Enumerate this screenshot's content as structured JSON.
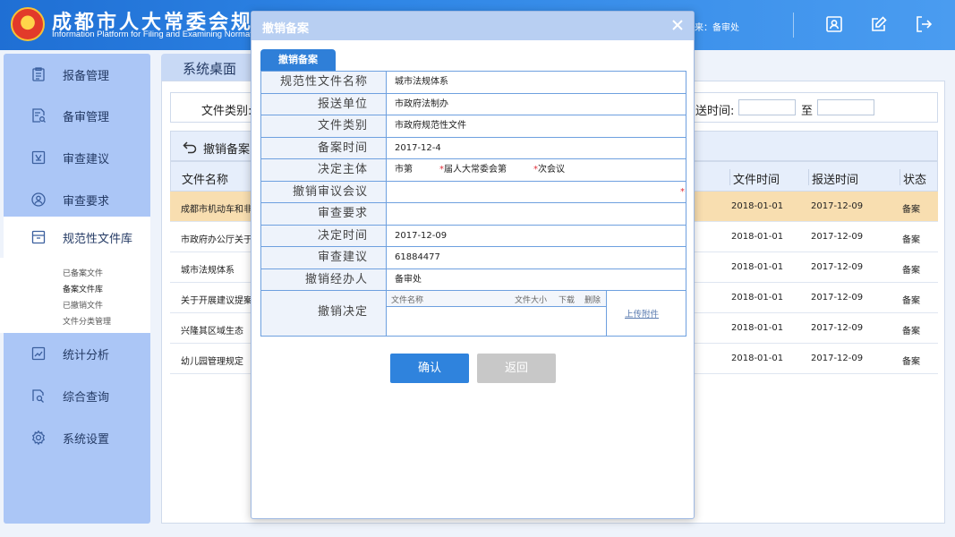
{
  "header": {
    "title_cn": "成都市人大常委会规范",
    "title_en": "Information Platform for Filing and Examining Normative D",
    "source": "来：备审处",
    "icons": [
      "contact-card-icon",
      "edit-icon",
      "logout-icon"
    ]
  },
  "sidebar": {
    "items": [
      {
        "label": "报备管理",
        "icon": "clipboard-icon"
      },
      {
        "label": "备审管理",
        "icon": "document-search-icon"
      },
      {
        "label": "审查建议",
        "icon": "suggestion-icon"
      },
      {
        "label": "审查要求",
        "icon": "user-circle-icon"
      },
      {
        "label": "规范性文件库",
        "icon": "archive-icon"
      },
      {
        "label": "统计分析",
        "icon": "chart-icon"
      },
      {
        "label": "综合查询",
        "icon": "search-doc-icon"
      },
      {
        "label": "系统设置",
        "icon": "gear-icon"
      }
    ],
    "sub_items": [
      {
        "label": "已备案文件"
      },
      {
        "label": "备案文件库"
      },
      {
        "label": "已撤销文件"
      },
      {
        "label": "文件分类管理"
      }
    ]
  },
  "main": {
    "tab_title": "系统桌面",
    "filter": {
      "category_label": "文件类别:",
      "date_label": "送时间:",
      "to_label": "至"
    },
    "action": {
      "label": "撤销备案"
    },
    "table": {
      "headers": {
        "name": "文件名称",
        "file_time": "文件时间",
        "send_time": "报送时间",
        "status": "状态"
      },
      "rows": [
        {
          "name": "成都市机动车和非",
          "file_time": "2018-01-01",
          "send_time": "2017-12-09",
          "status": "备案"
        },
        {
          "name": "市政府办公厅关于",
          "file_time": "2018-01-01",
          "send_time": "2017-12-09",
          "status": "备案"
        },
        {
          "name": "城市法规体系",
          "file_time": "2018-01-01",
          "send_time": "2017-12-09",
          "status": "备案"
        },
        {
          "name": "关于开展建议提案",
          "file_time": "2018-01-01",
          "send_time": "2017-12-09",
          "status": "备案"
        },
        {
          "name": "兴隆其区域生态",
          "file_time": "2018-01-01",
          "send_time": "2017-12-09",
          "status": "备案"
        },
        {
          "name": "幼儿园管理规定",
          "file_time": "2018-01-01",
          "send_time": "2017-12-09",
          "status": "备案"
        }
      ]
    }
  },
  "modal": {
    "title": "撤销备案",
    "tab": "撤销备案",
    "fields": {
      "doc_name": {
        "label": "规范性文件名称",
        "value": "城市法规体系"
      },
      "unit": {
        "label": "报送单位",
        "value": "市政府法制办"
      },
      "category": {
        "label": "文件类别",
        "value": "市政府规范性文件"
      },
      "filing_time": {
        "label": "备案时间",
        "value": "2017-12-4"
      },
      "subject": {
        "label": "决定主体",
        "part1": "市第",
        "part2": "届人大常委会第",
        "part3": "次会议"
      },
      "revoke_meeting": {
        "label": "撤销审议会议",
        "value": ""
      },
      "review_req": {
        "label": "审查要求",
        "value": ""
      },
      "decision_time": {
        "label": "决定时间",
        "value": "2017-12-09"
      },
      "review_sugg": {
        "label": "审查建议",
        "value": "61884477"
      },
      "handler": {
        "label": "撤销经办人",
        "value": "备审处"
      },
      "decision": {
        "label": "撤销决定"
      }
    },
    "attachments": {
      "col_name": "文件名称",
      "col_size": "文件大小",
      "col_download": "下载",
      "col_delete": "删除",
      "upload": "上传附件"
    },
    "buttons": {
      "confirm": "确认",
      "back": "返回"
    }
  }
}
